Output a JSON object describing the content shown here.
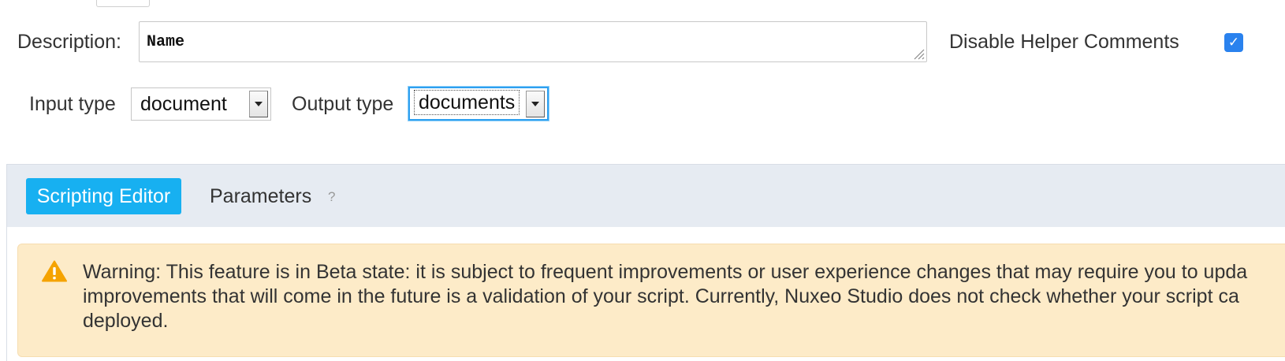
{
  "description": {
    "label": "Description:",
    "value": "Name"
  },
  "helper_comments": {
    "label": "Disable Helper Comments",
    "checked": true,
    "check_glyph": "✓"
  },
  "input_type": {
    "label": "Input type",
    "selected": "document"
  },
  "output_type": {
    "label": "Output type",
    "selected": "documents"
  },
  "tabs": [
    {
      "label": "Scripting Editor",
      "active": true
    },
    {
      "label": "Parameters",
      "active": false,
      "help": "?"
    }
  ],
  "warning": {
    "icon": "warning-triangle-icon",
    "lines": [
      "Warning: This feature is in Beta state: it is subject to frequent improvements or user experience changes that may require you to upda",
      "improvements that will come in the future is a validation of your script. Currently, Nuxeo Studio does not check whether your script ca",
      "deployed."
    ]
  },
  "colors": {
    "accent": "#17b0f1",
    "checkbox": "#2a82ee",
    "tab_bar_bg": "#e6ebf2",
    "warning_bg": "#fdebc8",
    "warning_icon": "#f5a300"
  }
}
